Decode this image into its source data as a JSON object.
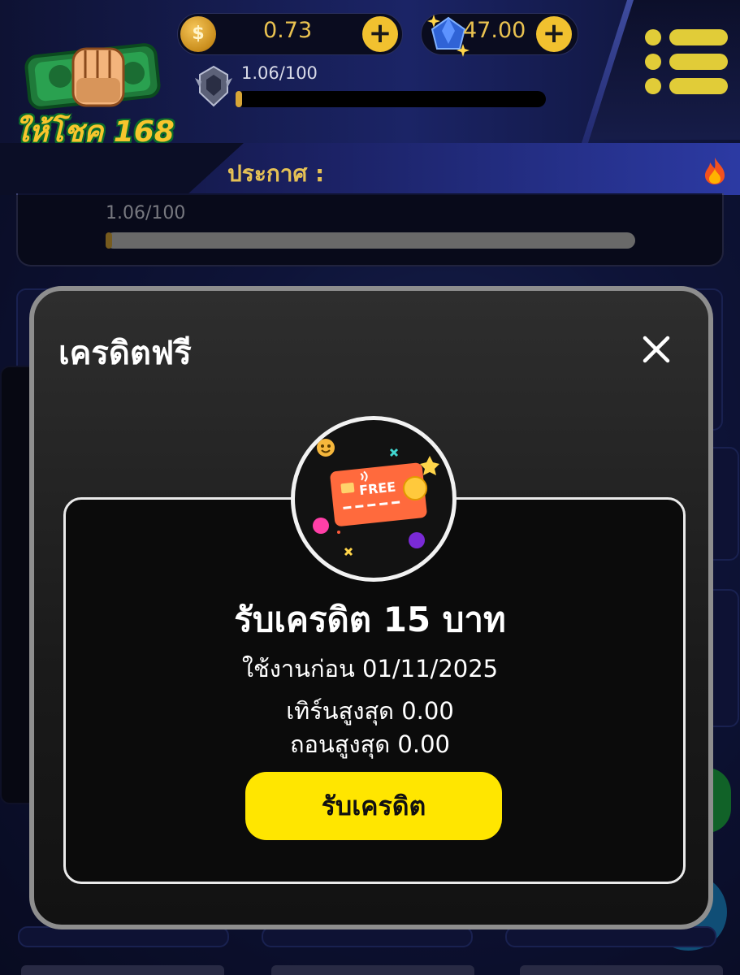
{
  "header": {
    "logo_text": "ให้โชค 168",
    "coin_symbol": "$",
    "coin_balance": "0.73",
    "gem_balance": "47.00",
    "plus_symbol": "+",
    "xp_text": "1.06/100",
    "xp_progress": 0.0106,
    "announcement_label": "ประกาศ :",
    "icons": [
      "coin-icon",
      "gem-icon",
      "rank-badge-icon",
      "menu-icon",
      "fire-icon",
      "fist-money-logo"
    ]
  },
  "progress_panel": {
    "text": "1.06/100",
    "progress": 0.0106
  },
  "modal": {
    "title": "เครดิตฟรี",
    "close_icon": "close-icon",
    "card_label": "FREE",
    "reward_title": "รับเครดิต 15 บาท",
    "expire_text": "ใช้งานก่อน 01/11/2025",
    "max_turnover_text": "เทิร์นสูงสุด 0.00",
    "max_withdraw_text": "ถอนสูงสุด 0.00",
    "claim_button": "รับเครดิต"
  },
  "colors": {
    "accent_gold": "#e9c250",
    "button_yellow": "#ffe600",
    "modal_bg": "#1a1a1a",
    "header_bg": "#1b2466"
  }
}
